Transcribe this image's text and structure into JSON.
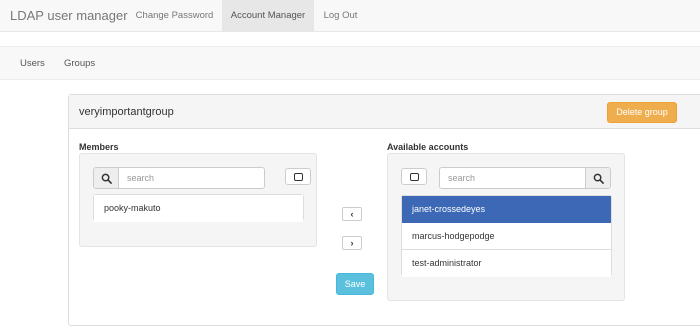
{
  "navbar": {
    "brand": "LDAP user manager",
    "links": [
      "Change Password",
      "Account Manager",
      "Log Out"
    ]
  },
  "subnav": {
    "links": [
      "Users",
      "Groups"
    ]
  },
  "group": {
    "name": "veryimportantgroup",
    "delete_label": "Delete group",
    "save_label": "Save"
  },
  "members": {
    "label": "Members",
    "search_placeholder": "search",
    "items": [
      "pooky-makuto"
    ]
  },
  "available": {
    "label": "Available accounts",
    "search_placeholder": "search",
    "items": [
      "janet-crossedeyes",
      "marcus-hodgepodge",
      "test-administrator"
    ],
    "selected_index": 0
  },
  "transfer": {
    "left_arrow": "‹",
    "right_arrow": "›"
  },
  "icons": {
    "search": "search-icon",
    "select_all": "square-icon"
  },
  "colors": {
    "selected": "#3c68b5",
    "delete": "#f0ad4e",
    "save": "#5bc0de"
  }
}
